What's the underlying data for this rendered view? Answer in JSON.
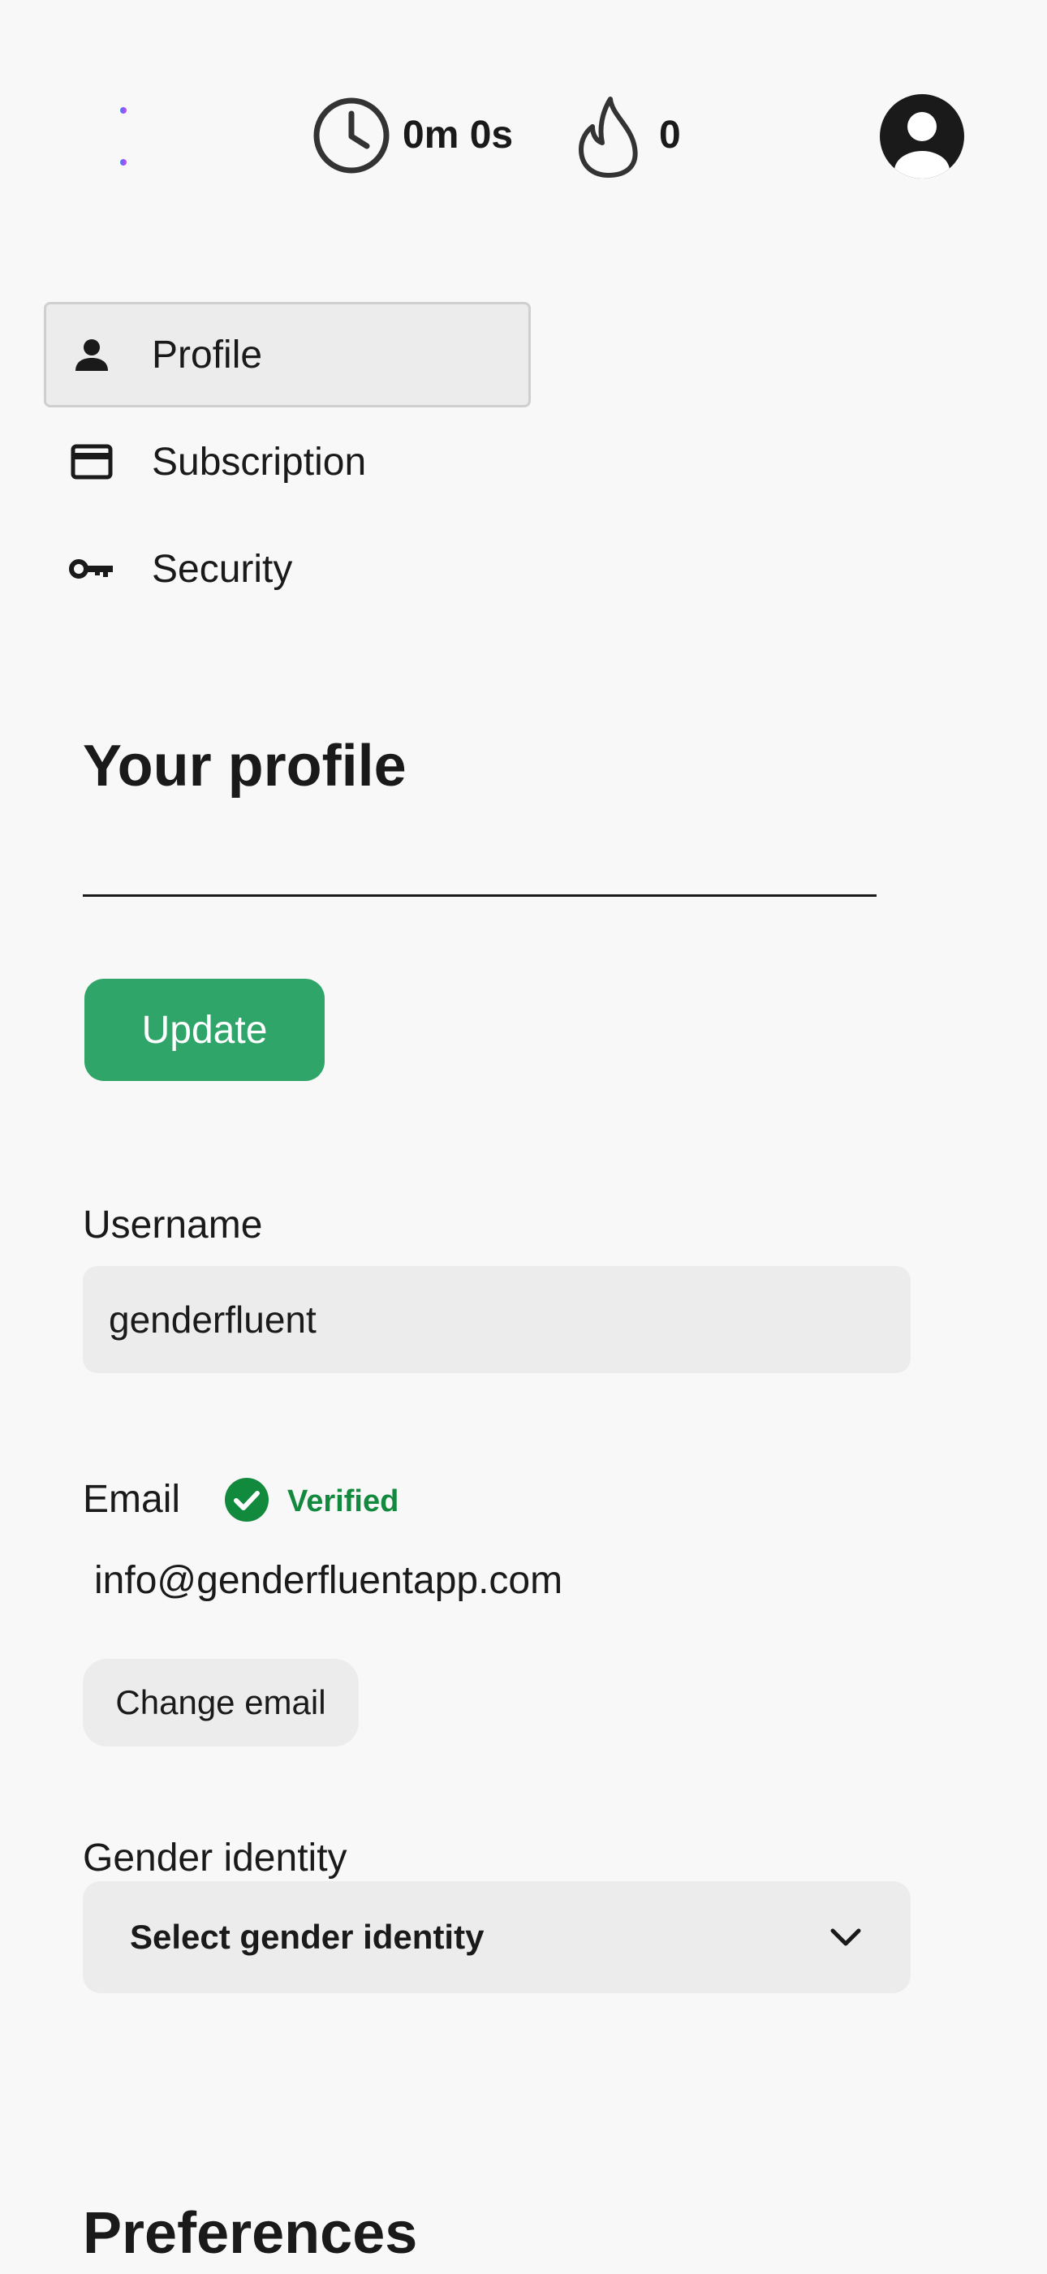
{
  "header": {
    "timer": "0m 0s",
    "streak": "0",
    "icons": [
      "waveform-logo-icon",
      "clock-icon",
      "flame-icon",
      "user-avatar-icon"
    ]
  },
  "sidebar": {
    "items": [
      {
        "label": "Profile",
        "icon": "person-icon",
        "active": true
      },
      {
        "label": "Subscription",
        "icon": "credit-card-icon",
        "active": false
      },
      {
        "label": "Security",
        "icon": "key-icon",
        "active": false
      }
    ]
  },
  "profile": {
    "title": "Your profile",
    "update_label": "Update",
    "username_label": "Username",
    "username_value": "genderfluent",
    "email_label": "Email",
    "verified_label": "Verified",
    "email_value": "info@genderfluentapp.com",
    "change_email_label": "Change email",
    "gender_label": "Gender identity",
    "gender_select_value": "Select gender identity"
  },
  "preferences": {
    "title": "Preferences"
  },
  "colors": {
    "accent_green": "#2fa56a",
    "verified_green": "#128a3e",
    "background": "#f8f8f8",
    "field_bg": "#ececec"
  }
}
